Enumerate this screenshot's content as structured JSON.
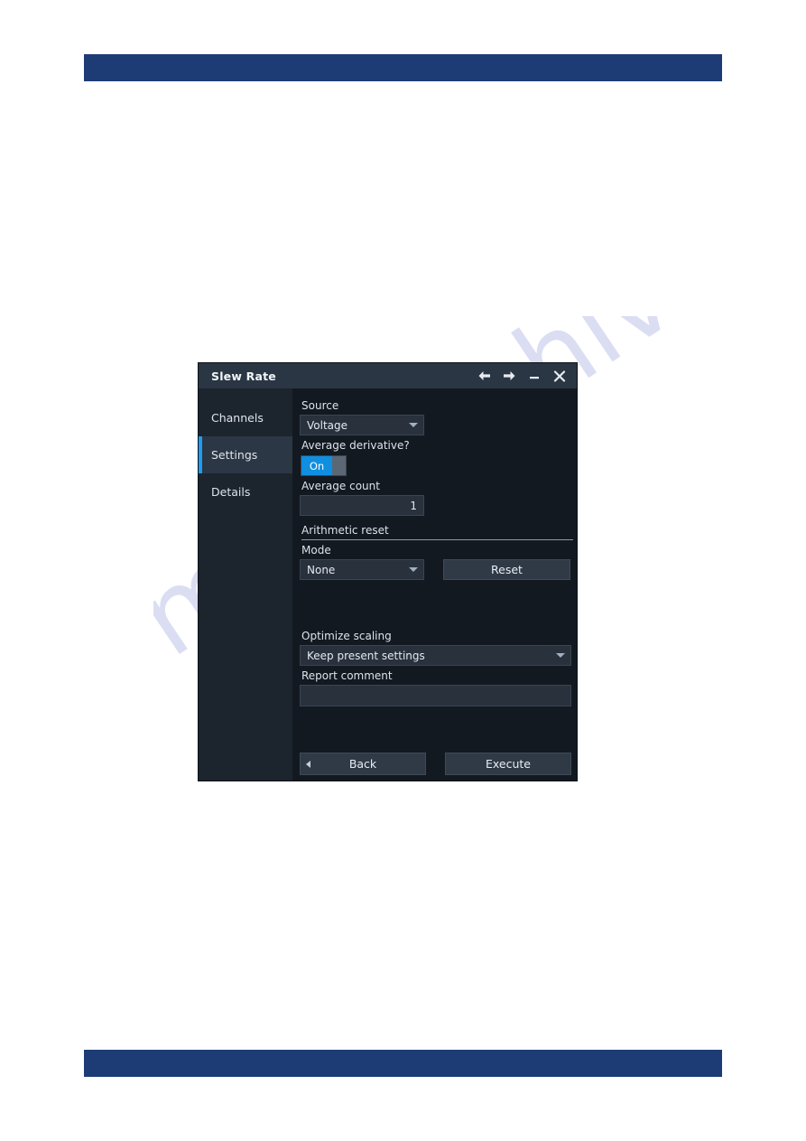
{
  "page": {
    "header_bar": {
      "name": "header-rule",
      "color": "#1d3c76"
    },
    "footer_bar": {
      "name": "footer-rule",
      "color": "#1d3c76"
    },
    "watermark_text": "manualshive.com"
  },
  "dialog": {
    "title": "Slew Rate",
    "title_buttons": [
      {
        "name": "back-arrow-icon",
        "label": "←"
      },
      {
        "name": "forward-arrow-icon",
        "label": "→"
      },
      {
        "name": "minimize-icon",
        "label": "—"
      },
      {
        "name": "close-icon",
        "label": "✕"
      }
    ],
    "sidebar": {
      "items": [
        {
          "label": "Channels",
          "active": false
        },
        {
          "label": "Settings",
          "active": true
        },
        {
          "label": "Details",
          "active": false
        }
      ],
      "active_indicator_color": "#1f9cf0"
    },
    "settings": {
      "source": {
        "label": "Source",
        "value": "Voltage"
      },
      "average_derivative": {
        "label": "Average derivative?",
        "value": "On"
      },
      "average_count": {
        "label": "Average count",
        "value": "1"
      },
      "arithmetic_reset": {
        "section_label": "Arithmetic reset",
        "mode_label": "Mode",
        "mode_value": "None",
        "reset_button": "Reset"
      },
      "optimize_scaling": {
        "label": "Optimize scaling",
        "value": "Keep present settings"
      },
      "report_comment": {
        "label": "Report comment",
        "value": "",
        "placeholder": ""
      }
    },
    "footer_buttons": {
      "back": "Back",
      "execute": "Execute"
    }
  }
}
